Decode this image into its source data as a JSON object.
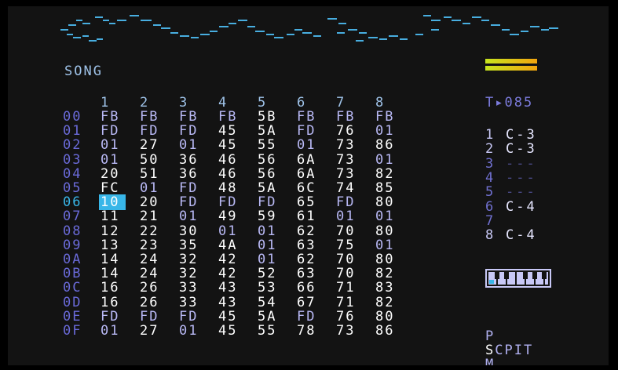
{
  "screen": {
    "title": "SONG"
  },
  "columns": [
    "1",
    "2",
    "3",
    "4",
    "5",
    "6",
    "7",
    "8"
  ],
  "rows": [
    {
      "label": "00",
      "cells": [
        "FB",
        "FB",
        "FB",
        "FB",
        "5B",
        "FB",
        "FB",
        "FB"
      ]
    },
    {
      "label": "01",
      "cells": [
        "FD",
        "FD",
        "FD",
        "45",
        "5A",
        "FD",
        "76",
        "01"
      ]
    },
    {
      "label": "02",
      "cells": [
        "01",
        "27",
        "01",
        "45",
        "55",
        "01",
        "73",
        "86"
      ]
    },
    {
      "label": "03",
      "cells": [
        "01",
        "50",
        "36",
        "46",
        "56",
        "6A",
        "73",
        "01"
      ]
    },
    {
      "label": "04",
      "cells": [
        "20",
        "51",
        "36",
        "46",
        "56",
        "6A",
        "73",
        "82"
      ]
    },
    {
      "label": "05",
      "cells": [
        "FC",
        "01",
        "FD",
        "48",
        "5A",
        "6C",
        "74",
        "85"
      ]
    },
    {
      "label": "06",
      "cells": [
        "10",
        "20",
        "FD",
        "FD",
        "FD",
        "65",
        "FD",
        "80"
      ]
    },
    {
      "label": "07",
      "cells": [
        "11",
        "21",
        "01",
        "49",
        "59",
        "61",
        "01",
        "01"
      ]
    },
    {
      "label": "08",
      "cells": [
        "12",
        "22",
        "30",
        "01",
        "01",
        "62",
        "70",
        "80"
      ]
    },
    {
      "label": "09",
      "cells": [
        "13",
        "23",
        "35",
        "4A",
        "01",
        "63",
        "75",
        "01"
      ]
    },
    {
      "label": "0A",
      "cells": [
        "14",
        "24",
        "32",
        "42",
        "01",
        "62",
        "70",
        "80"
      ]
    },
    {
      "label": "0B",
      "cells": [
        "14",
        "24",
        "32",
        "42",
        "52",
        "63",
        "70",
        "82"
      ]
    },
    {
      "label": "0C",
      "cells": [
        "16",
        "26",
        "33",
        "43",
        "53",
        "66",
        "71",
        "83"
      ]
    },
    {
      "label": "0D",
      "cells": [
        "16",
        "26",
        "33",
        "43",
        "54",
        "67",
        "71",
        "82"
      ]
    },
    {
      "label": "0E",
      "cells": [
        "FD",
        "FD",
        "FD",
        "45",
        "5A",
        "FD",
        "76",
        "80"
      ]
    },
    {
      "label": "0F",
      "cells": [
        "01",
        "27",
        "01",
        "45",
        "55",
        "78",
        "73",
        "86"
      ]
    }
  ],
  "cursor": {
    "row": 6,
    "col": 0
  },
  "active_row": 6,
  "tempo": "T▸085",
  "channels": [
    {
      "num": "1",
      "note": "C-3"
    },
    {
      "num": "2",
      "note": "C-3"
    },
    {
      "num": "3",
      "note": "---"
    },
    {
      "num": "4",
      "note": "---"
    },
    {
      "num": "5",
      "note": "---"
    },
    {
      "num": "6",
      "note": "C-4"
    },
    {
      "num": "7",
      "note": ""
    },
    {
      "num": "8",
      "note": "C-4"
    }
  ],
  "menu": {
    "p": "P",
    "scpit_first": "S",
    "scpit_rest": "CPIT",
    "m": "M"
  },
  "volume_level": 1.0,
  "colors": {
    "accent": "#38b6e8",
    "row_label": "#6a6ad8",
    "wave": "#48aee0",
    "volume_start": "#c7e41e",
    "volume_end": "#f3a50e"
  },
  "icons": {
    "keyboard": "piano-keyboard-icon",
    "volume": "volume-meter-icon"
  }
}
